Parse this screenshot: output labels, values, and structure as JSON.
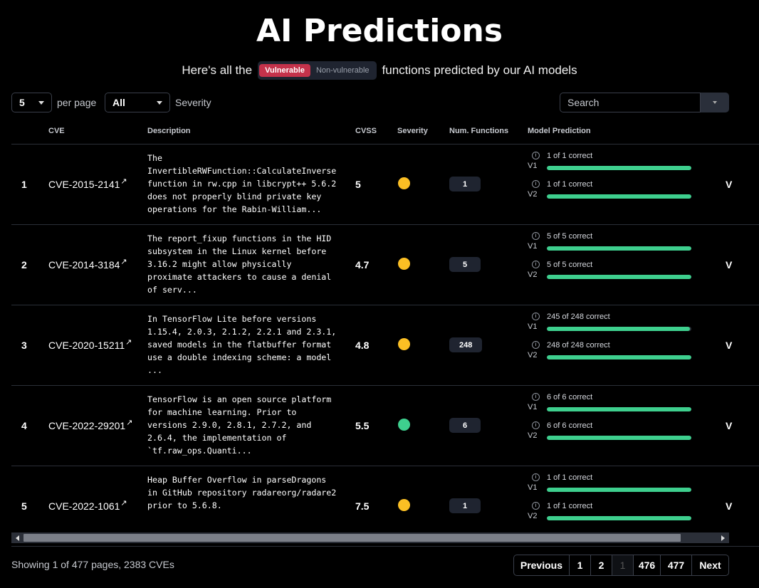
{
  "page": {
    "title": "AI Predictions",
    "subtitle_before": "Here's all the",
    "subtitle_after": "functions predicted by our AI models",
    "toggle": {
      "vulnerable": "Vulnerable",
      "non_vulnerable": "Non-vulnerable"
    }
  },
  "controls": {
    "per_page_value": "5",
    "per_page_label": "per page",
    "severity_value": "All",
    "severity_label": "Severity",
    "search_placeholder": "Search"
  },
  "table": {
    "headers": {
      "cve": "CVE",
      "description": "Description",
      "cvss": "CVSS",
      "severity": "Severity",
      "num_functions": "Num. Functions",
      "model_prediction": "Model Prediction"
    },
    "view_label": "V",
    "rows": [
      {
        "index": "1",
        "cve": "CVE-2015-2141",
        "description": "The\nInvertibleRWFunction::CalculateInverse\nfunction in rw.cpp in libcrypt++ 5.6.2\ndoes not properly blind private key\noperations for the Rabin-William...",
        "cvss": "5",
        "severity_color": "#fbbf24",
        "num_functions": "1",
        "v1_label": "V1",
        "v1_text": "1 of 1 correct",
        "v1_ratio": 1.0,
        "v2_label": "V2",
        "v2_text": "1 of 1 correct",
        "v2_ratio": 1.0
      },
      {
        "index": "2",
        "cve": "CVE-2014-3184",
        "description": "The report_fixup functions in the HID\nsubsystem in the Linux kernel before\n3.16.2 might allow physically\nproximate attackers to cause a denial\nof serv...",
        "cvss": "4.7",
        "severity_color": "#fbbf24",
        "num_functions": "5",
        "v1_label": "V1",
        "v1_text": "5 of 5 correct",
        "v1_ratio": 1.0,
        "v2_label": "V2",
        "v2_text": "5 of 5 correct",
        "v2_ratio": 1.0
      },
      {
        "index": "3",
        "cve": "CVE-2020-15211",
        "description": "In TensorFlow Lite before versions\n1.15.4, 2.0.3, 2.1.2, 2.2.1 and 2.3.1,\nsaved models in the flatbuffer format\nuse a double indexing scheme: a model\n...",
        "cvss": "4.8",
        "severity_color": "#fbbf24",
        "num_functions": "248",
        "v1_label": "V1",
        "v1_text": "245 of 248 correct",
        "v1_ratio": 0.988,
        "v2_label": "V2",
        "v2_text": "248 of 248 correct",
        "v2_ratio": 1.0
      },
      {
        "index": "4",
        "cve": "CVE-2022-29201",
        "description": "TensorFlow is an open source platform\nfor machine learning. Prior to\nversions 2.9.0, 2.8.1, 2.7.2, and\n2.6.4, the implementation of\n`tf.raw_ops.Quanti...",
        "cvss": "5.5",
        "severity_color": "#3ecf8e",
        "num_functions": "6",
        "v1_label": "V1",
        "v1_text": "6 of 6 correct",
        "v1_ratio": 1.0,
        "v2_label": "V2",
        "v2_text": "6 of 6 correct",
        "v2_ratio": 1.0
      },
      {
        "index": "5",
        "cve": "CVE-2022-1061",
        "description": "Heap Buffer Overflow in parseDragons\nin GitHub repository radareorg/radare2\nprior to 5.6.8.",
        "cvss": "7.5",
        "severity_color": "#fbbf24",
        "num_functions": "1",
        "v1_label": "V1",
        "v1_text": "1 of 1 correct",
        "v1_ratio": 1.0,
        "v2_label": "V2",
        "v2_text": "1 of 1 correct",
        "v2_ratio": 1.0
      }
    ]
  },
  "footer": {
    "status": "Showing 1 of 477 pages, 2383 CVEs",
    "pager": {
      "previous": "Previous",
      "pages": [
        "1",
        "2",
        "",
        "476",
        "477"
      ],
      "next": "Next"
    }
  },
  "colors": {
    "accent_green": "#3ecf8e",
    "severity_medium": "#fbbf24",
    "vulnerable_red": "#c4324b"
  }
}
